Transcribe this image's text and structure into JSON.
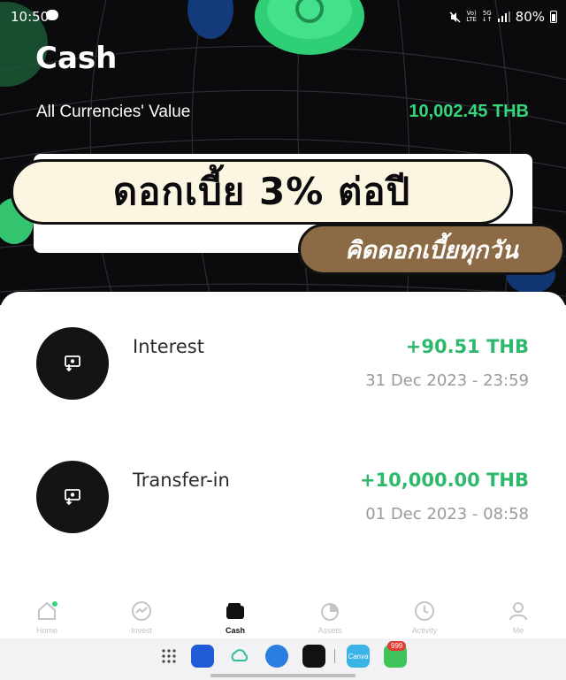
{
  "status_bar": {
    "time": "10:50",
    "battery": "80%",
    "network_1": "Vo)\nLTE",
    "network_2": "5G\n↓↑"
  },
  "header": {
    "title": "Cash",
    "total_label": "All Currencies' Value",
    "total_value": "10,002.45 THB"
  },
  "banner": {
    "headline": "ดอกเบี้ย 3% ต่อปี",
    "subline": "คิดดอกเบี้ยทุกวัน"
  },
  "transactions": [
    {
      "title": "Interest",
      "amount": "+90.51 THB",
      "date": "31 Dec 2023 - 23:59",
      "icon": "deposit-icon"
    },
    {
      "title": "Transfer-in",
      "amount": "+10,000.00 THB",
      "date": "01 Dec 2023 - 08:58",
      "icon": "deposit-icon"
    }
  ],
  "nav": {
    "active": "Cash",
    "items": [
      {
        "label": "Home",
        "icon": "home-icon"
      },
      {
        "label": "Invest",
        "icon": "chart-icon"
      },
      {
        "label": "Cash",
        "icon": "wallet-icon"
      },
      {
        "label": "Assets",
        "icon": "pie-icon"
      },
      {
        "label": "Activity",
        "icon": "clock-icon"
      },
      {
        "label": "Me",
        "icon": "person-icon"
      }
    ]
  },
  "taskbar": {
    "badge": "999",
    "canva_label": "Canva"
  },
  "colors": {
    "accent_green": "#34d77b",
    "amount_green": "#2eb86b",
    "hero_bg": "#0b0b0d",
    "banner_brown": "#8c6a46",
    "banner_cream": "#fcf5e1"
  }
}
